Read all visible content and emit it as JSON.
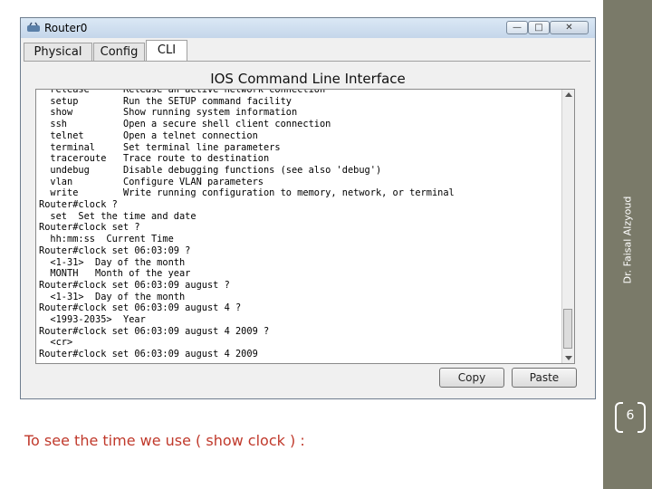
{
  "window": {
    "title": "Router0",
    "tabs": [
      {
        "label": "Physical"
      },
      {
        "label": "Config"
      },
      {
        "label": "CLI"
      }
    ],
    "active_tab": "CLI",
    "heading": "IOS Command Line Interface",
    "terminal_lines": [
      "  release      Release an active network connection",
      "  setup        Run the SETUP command facility",
      "  show         Show running system information",
      "  ssh          Open a secure shell client connection",
      "  telnet       Open a telnet connection",
      "  terminal     Set terminal line parameters",
      "  traceroute   Trace route to destination",
      "  undebug      Disable debugging functions (see also 'debug')",
      "  vlan         Configure VLAN parameters",
      "  write        Write running configuration to memory, network, or terminal",
      "Router#clock ?",
      "  set  Set the time and date",
      "Router#clock set ?",
      "  hh:mm:ss  Current Time",
      "Router#clock set 06:03:09 ?",
      "  <1-31>  Day of the month",
      "  MONTH   Month of the year",
      "Router#clock set 06:03:09 august ?",
      "  <1-31>  Day of the month",
      "Router#clock set 06:03:09 august 4 ?",
      "  <1993-2035>  Year",
      "Router#clock set 06:03:09 august 4 2009 ?",
      "  <cr>",
      "Router#clock set 06:03:09 august 4 2009"
    ],
    "copy_label": "Copy",
    "paste_label": "Paste"
  },
  "slide": {
    "caption": "To see the time we use ( show clock ) :",
    "author": "Dr. Faisal Alzyoud",
    "page_number": "6"
  },
  "colors": {
    "sidebar": "#7a7a69",
    "caption": "#c0392b"
  }
}
